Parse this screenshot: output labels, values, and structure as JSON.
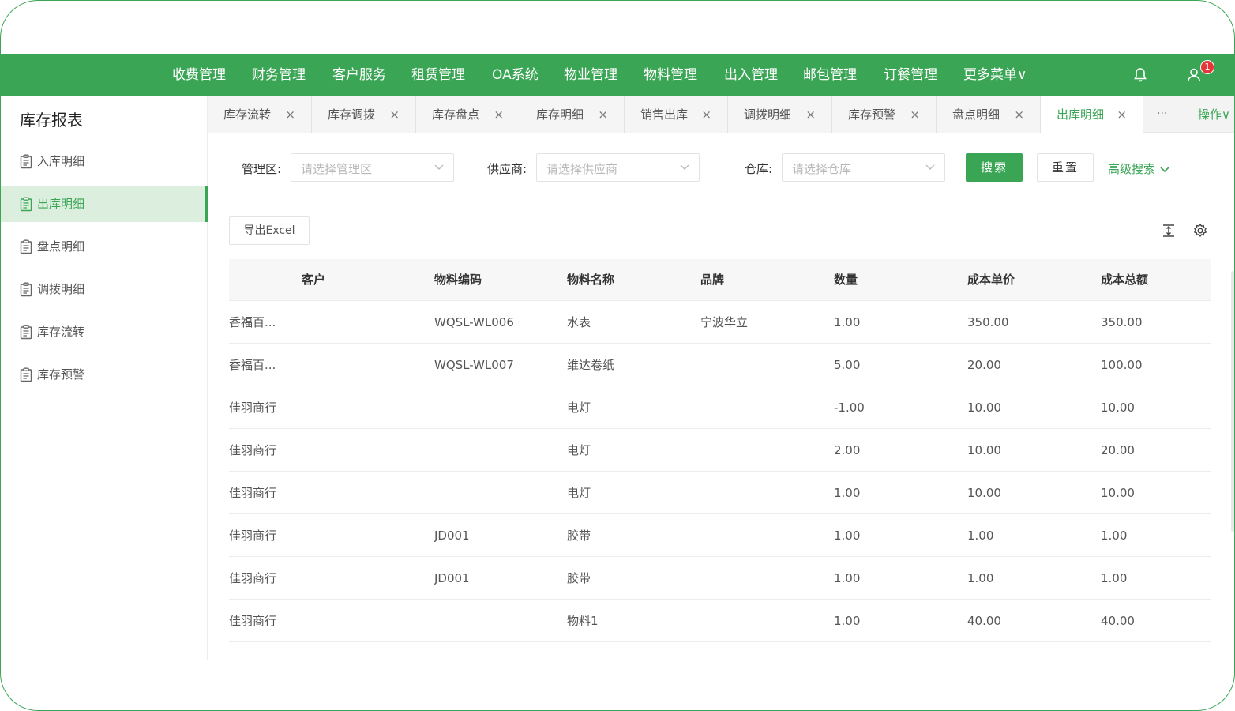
{
  "nav": {
    "items": [
      "收费管理",
      "财务管理",
      "客户服务",
      "租赁管理",
      "OA系统",
      "物业管理",
      "物料管理",
      "出入管理",
      "邮包管理",
      "订餐管理",
      "更多菜单∨"
    ],
    "badge": "1"
  },
  "sidebar": {
    "title": "库存报表",
    "items": [
      "入库明细",
      "出库明细",
      "盘点明细",
      "调拨明细",
      "库存流转",
      "库存预警"
    ],
    "active_index": 1
  },
  "tabs": {
    "items": [
      "库存流转",
      "库存调拨",
      "库存盘点",
      "库存明细",
      "销售出库",
      "调拨明细",
      "库存预警",
      "盘点明细",
      "出库明细"
    ],
    "active_index": 8,
    "close": "×",
    "more": "···",
    "ops": "操作∨"
  },
  "filters": {
    "area_label": "管理区:",
    "area_placeholder": "请选择管理区",
    "supplier_label": "供应商:",
    "supplier_placeholder": "请选择供应商",
    "warehouse_label": "仓库:",
    "warehouse_placeholder": "请选择仓库",
    "search": "搜索",
    "reset": "重置",
    "advanced": "高级搜索"
  },
  "toolbar": {
    "export": "导出Excel"
  },
  "table": {
    "headers": [
      "客户",
      "物料编码",
      "物料名称",
      "品牌",
      "数量",
      "成本单价",
      "成本总额"
    ],
    "rows": [
      [
        "香福百...",
        "WQSL-WL006",
        "水表",
        "宁波华立",
        "1.00",
        "350.00",
        "350.00"
      ],
      [
        "香福百...",
        "WQSL-WL007",
        "维达卷纸",
        "",
        "5.00",
        "20.00",
        "100.00"
      ],
      [
        "佳羽商行",
        "",
        "电灯",
        "",
        "-1.00",
        "10.00",
        "10.00"
      ],
      [
        "佳羽商行",
        "",
        "电灯",
        "",
        "2.00",
        "10.00",
        "20.00"
      ],
      [
        "佳羽商行",
        "",
        "电灯",
        "",
        "1.00",
        "10.00",
        "10.00"
      ],
      [
        "佳羽商行",
        "JD001",
        "胶带",
        "",
        "1.00",
        "1.00",
        "1.00"
      ],
      [
        "佳羽商行",
        "JD001",
        "胶带",
        "",
        "1.00",
        "1.00",
        "1.00"
      ],
      [
        "佳羽商行",
        "",
        "物料1",
        "",
        "1.00",
        "40.00",
        "40.00"
      ]
    ]
  },
  "colors": {
    "brand": "#3aa655",
    "badge": "#e5373a",
    "active_bg": "#dcefdf"
  }
}
